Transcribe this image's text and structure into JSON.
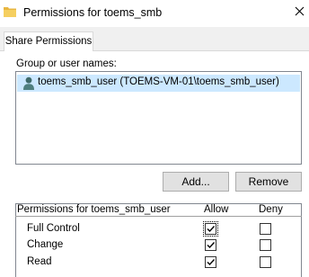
{
  "window": {
    "title": "Permissions for toems_smb",
    "icons": {
      "folder": "folder-icon",
      "close": "close-icon",
      "user": "user-icon"
    }
  },
  "tabs": [
    {
      "label": "Share Permissions",
      "active": true
    }
  ],
  "group_users": {
    "label": "Group or user names:",
    "items": [
      {
        "name": "toems_smb_user (TOEMS-VM-01\\toems_smb_user)",
        "selected": true
      }
    ]
  },
  "buttons": {
    "add": "Add...",
    "remove": "Remove"
  },
  "permissions": {
    "header": "Permissions for toems_smb_user",
    "allow_label": "Allow",
    "deny_label": "Deny",
    "rows": [
      {
        "name": "Full Control",
        "allow": true,
        "deny": false
      },
      {
        "name": "Change",
        "allow": true,
        "deny": false
      },
      {
        "name": "Read",
        "allow": true,
        "deny": false
      }
    ]
  },
  "colors": {
    "selection": "#cce8ff",
    "button_face": "#e1e1e1",
    "tab_strip": "#f0f0f0",
    "folder": "#e8b640"
  }
}
